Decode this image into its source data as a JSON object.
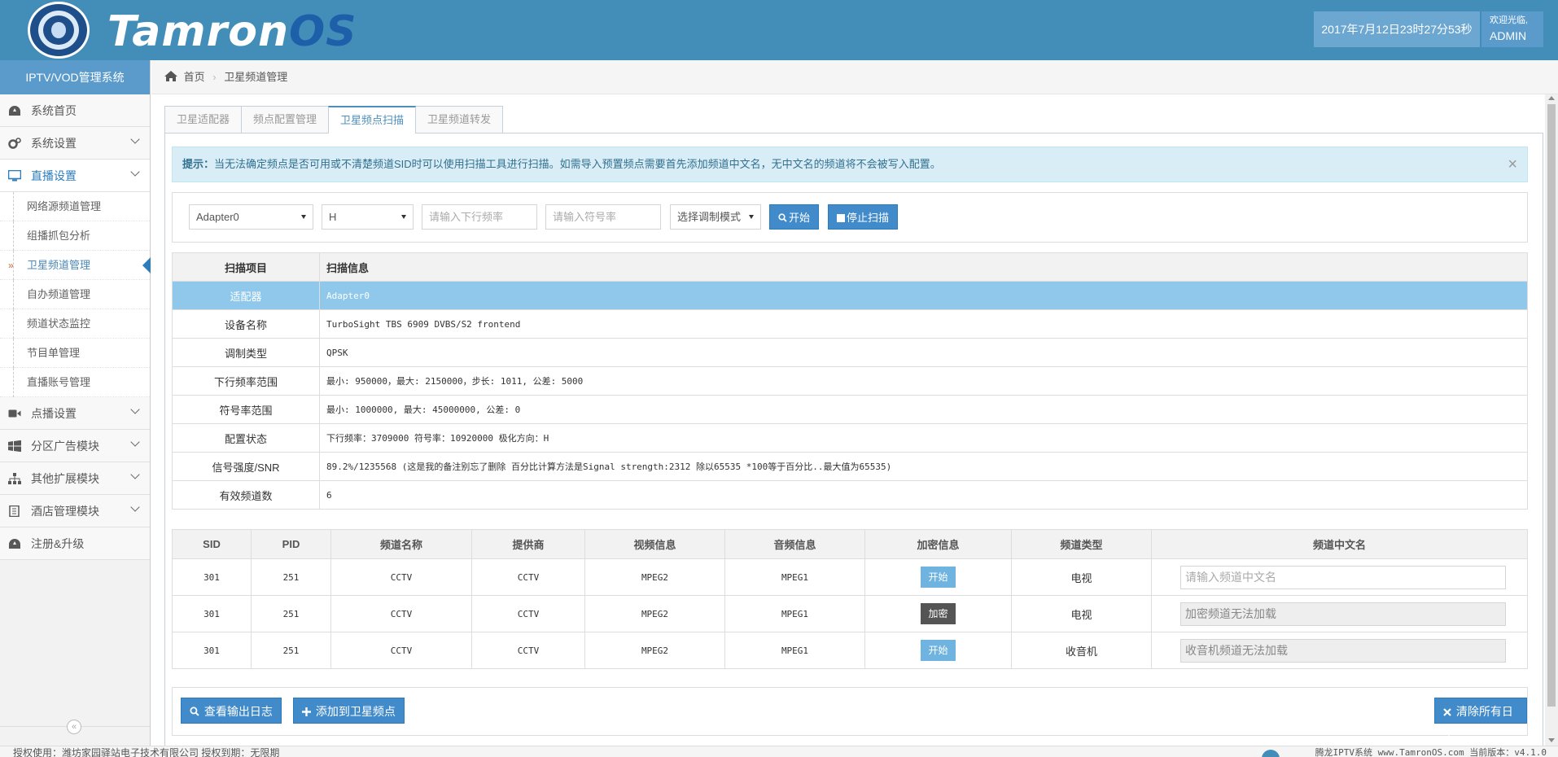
{
  "header": {
    "brand_part1": "Tamron",
    "brand_part2": "OS",
    "datetime": "2017年7月12日23时27分53秒",
    "welcome": "欢迎光临,",
    "user": "ADMIN"
  },
  "sidebar": {
    "title": "IPTV/VOD管理系统",
    "items": [
      {
        "label": "系统首页",
        "icon": "dashboard-icon"
      },
      {
        "label": "系统设置",
        "icon": "cogs-icon"
      },
      {
        "label": "直播设置",
        "icon": "desktop-icon"
      },
      {
        "label": "点播设置",
        "icon": "video-camera-icon"
      },
      {
        "label": "分区广告模块",
        "icon": "windows-icon"
      },
      {
        "label": "其他扩展模块",
        "icon": "sitemap-icon"
      },
      {
        "label": "酒店管理模块",
        "icon": "book-icon"
      },
      {
        "label": "注册&升级",
        "icon": "dashboard-icon"
      }
    ],
    "sub_items": [
      "网络源频道管理",
      "组播抓包分析",
      "卫星频道管理",
      "自办频道管理",
      "频道状态监控",
      "节目单管理",
      "直播账号管理"
    ],
    "active_marker": "»",
    "collapse_icon": "«"
  },
  "breadcrumb": {
    "home": "首页",
    "current": "卫星频道管理"
  },
  "tabs": [
    "卫星适配器",
    "频点配置管理",
    "卫星频点扫描",
    "卫星频道转发"
  ],
  "alert": {
    "title": "提示：",
    "text": "当无法确定频点是否可用或不清楚频道SID时可以使用扫描工具进行扫描。如需导入预置频点需要首先添加频道中文名，无中文名的频道将不会被写入配置。",
    "close": "×"
  },
  "filter": {
    "adapter": "Adapter0",
    "polarity": "H",
    "freq_placeholder": "请输入下行频率",
    "symbol_placeholder": "请输入符号率",
    "mod_placeholder": "选择调制模式",
    "start_label": "开始",
    "stop_label": "停止扫描"
  },
  "scan_table": {
    "headers": [
      "扫描项目",
      "扫描信息"
    ],
    "rows": [
      {
        "key": "适配器",
        "value": "Adapter0"
      },
      {
        "key": "设备名称",
        "value": "TurboSight TBS 6909 DVBS/S2 frontend"
      },
      {
        "key": "调制类型",
        "value": "QPSK"
      },
      {
        "key": "下行频率范围",
        "value": "最小: 950000，最大: 2150000，步长: 1011, 公差: 5000"
      },
      {
        "key": "符号率范围",
        "value": "最小: 1000000, 最大: 45000000, 公差: 0"
      },
      {
        "key": "配置状态",
        "value": "下行频率：3709000 符号率：10920000 极化方向：H"
      },
      {
        "key": "信号强度/SNR",
        "value": "89.2%/1235568 (这是我的备注别忘了删除 百分比计算方法是Signal strength:2312 除以65535 *100等于百分比..最大值为65535)"
      },
      {
        "key": "有效频道数",
        "value": "6"
      }
    ]
  },
  "channel_table": {
    "headers": [
      "SID",
      "PID",
      "频道名称",
      "提供商",
      "视频信息",
      "音频信息",
      "加密信息",
      "频道类型",
      "频道中文名"
    ],
    "rows": [
      {
        "sid": "301",
        "pid": "251",
        "name": "CCTV",
        "provider": "CCTV",
        "video": "MPEG2",
        "audio": "MPEG1",
        "enc": "开始",
        "type": "电视",
        "cn": "请输入频道中文名"
      },
      {
        "sid": "301",
        "pid": "251",
        "name": "CCTV",
        "provider": "CCTV",
        "video": "MPEG2",
        "audio": "MPEG1",
        "enc": "加密",
        "type": "电视",
        "cn": "加密频道无法加载"
      },
      {
        "sid": "301",
        "pid": "251",
        "name": "CCTV",
        "provider": "CCTV",
        "video": "MPEG2",
        "audio": "MPEG1",
        "enc": "开始",
        "type": "收音机",
        "cn": "收音机频道无法加载"
      }
    ]
  },
  "actions": {
    "view_log": "查看输出日志",
    "add_freq": "添加到卫星频点",
    "clear_log": "清除所有日志"
  },
  "footer": {
    "left": "授权使用：潍坊家园驿站电子技术有限公司 授权到期：无限期",
    "right": "腾龙IPTV系统 www.TamronOS.com 当前版本：v4.1.0"
  },
  "colors": {
    "header_bg": "#438eb9",
    "sidebar_title_bg": "#5a9bcb",
    "primary_button": "#428bca",
    "alert_bg": "#d9edf7",
    "selected_row": "#8fc8ea",
    "badge_open": "#6fb3e0",
    "badge_encrypted": "#555555"
  }
}
